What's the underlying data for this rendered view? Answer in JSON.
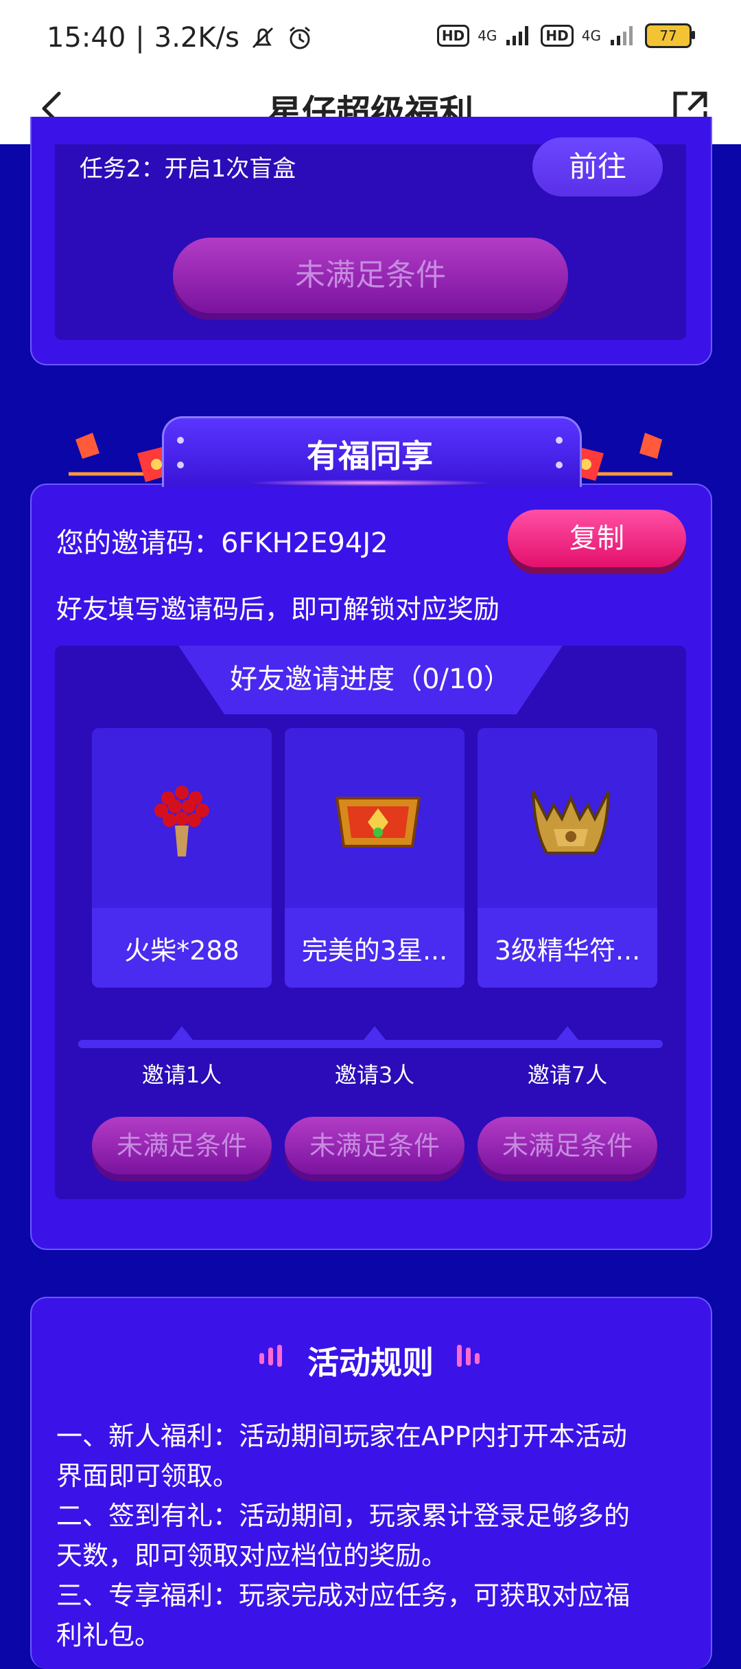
{
  "status_bar": {
    "time": "15:40",
    "network_speed": "3.2K/s",
    "hd1": "HD",
    "signal1": "4G",
    "hd2": "HD",
    "signal2": "4G",
    "battery": "77"
  },
  "nav": {
    "title": "星仔超级福利"
  },
  "task": {
    "label": "任务2：开启1次盲盒",
    "go_button": "前往",
    "claim_button": "未满足条件"
  },
  "invite": {
    "header": "有福同享",
    "code_label": "您的邀请码：6FKH2E94J2",
    "copy_button": "复制",
    "hint": "好友填写邀请码后，即可解锁对应奖励",
    "progress_title": "好友邀请进度（0/10）",
    "rewards": [
      {
        "name": "火柴*288",
        "icon": "matches-bouquet-icon",
        "tier": "邀请1人",
        "button": "未满足条件"
      },
      {
        "name": "完美的3星...",
        "icon": "golden-chest-icon",
        "tier": "邀请3人",
        "button": "未满足条件"
      },
      {
        "name": "3级精华符...",
        "icon": "golden-crown-icon",
        "tier": "邀请7人",
        "button": "未满足条件"
      }
    ]
  },
  "rules": {
    "title": "活动规则",
    "lines": [
      "一、新人福利：活动期间玩家在APP内打开本活动",
      "界面即可领取。",
      "二、签到有礼：活动期间，玩家累计登录足够多的",
      "天数，即可领取对应档位的奖励。",
      "三、专享福利：玩家完成对应任务，可获取对应福",
      "利礼包。"
    ]
  },
  "colors": {
    "background": "#0a06a8",
    "card": "#3b13e8",
    "copy_button": "#e3106c",
    "disabled_button": "#8a1aa8"
  }
}
